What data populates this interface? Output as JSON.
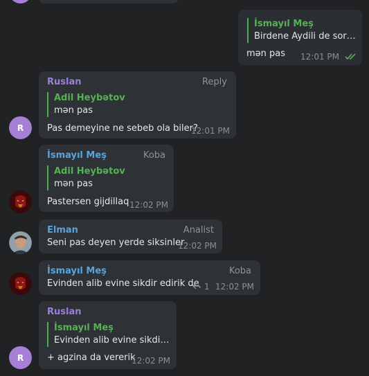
{
  "colors": {
    "background": "#212224",
    "bubble": "#2e3136",
    "sender_purple": "#9c7fe0",
    "sender_blue": "#57a5dc",
    "quote_green": "#58b057",
    "time_gray": "#8b9095"
  },
  "messages": [
    {
      "quote_name": "İsmayıl Meş",
      "quote_text": "Birdene Aydili de sorus...",
      "text": "mən pas",
      "time": "12:01 PM",
      "status_icon": "double-check-icon"
    },
    {
      "sender": "Ruslan",
      "badge": "Reply",
      "quote_name": "Adil Heybətov",
      "quote_text": "mən pas",
      "text": "Pas demeyine ne sebeb ola biler?",
      "time": "12:01 PM",
      "avatar_letter": "R"
    },
    {
      "sender": "İsmayıl Meş",
      "badge": "Koba",
      "quote_name": "Adil Heybətov",
      "quote_text": "mən pas",
      "text": "Pastersen gijdillaq",
      "time": "12:02 PM",
      "avatar_icon": "ironman-avatar-icon"
    },
    {
      "sender": "Elman",
      "badge": "Analist",
      "text": "Seni pas deyen yerde siksinler",
      "time": "12:02 PM",
      "avatar_icon": "user-photo-avatar"
    },
    {
      "sender": "İsmayıl Meş",
      "badge": "Koba",
      "text": "Evinden alib evine sikdir edirik de",
      "reply_count": "1",
      "time": "12:02 PM",
      "avatar_icon": "ironman-avatar-icon"
    },
    {
      "sender": "Ruslan",
      "quote_name": "İsmayıl Meş",
      "quote_text": "Evinden alib evine sikdir e...",
      "text": "+ agzina da vererik",
      "time": "12:02 PM",
      "avatar_letter": "R"
    }
  ]
}
